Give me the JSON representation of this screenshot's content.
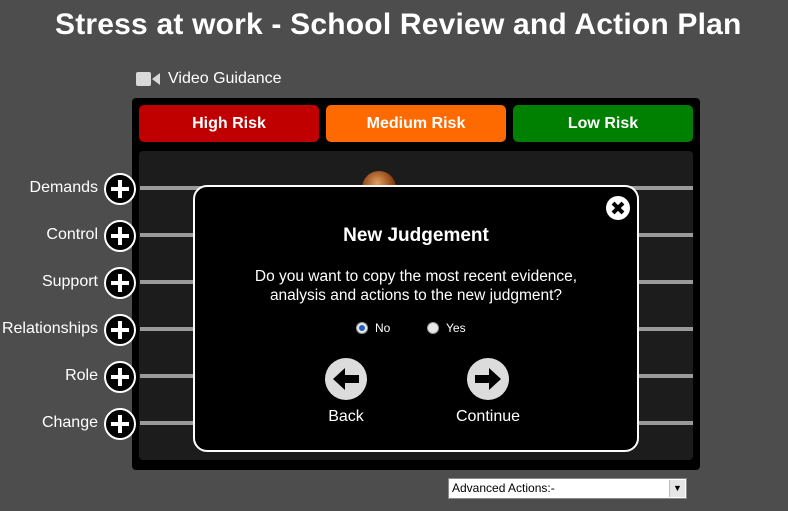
{
  "header": {
    "title": "Stress at work - School Review and Action Plan"
  },
  "video": {
    "label": "Video Guidance",
    "icon": "video-camera-icon"
  },
  "risk_buttons": [
    {
      "label": "High Risk",
      "color": "#c00000"
    },
    {
      "label": "Medium Risk",
      "color": "#ff6a00"
    },
    {
      "label": "Low Risk",
      "color": "#008000"
    }
  ],
  "rows": [
    {
      "label": "Demands"
    },
    {
      "label": "Control"
    },
    {
      "label": "Support"
    },
    {
      "label": "Relationships"
    },
    {
      "label": "Role"
    },
    {
      "label": "Change"
    }
  ],
  "modal": {
    "title": "New Judgement",
    "message_line1": "Do you want to copy the most recent evidence,",
    "message_line2": "analysis and actions to the new judgment?",
    "options": [
      {
        "label": "No",
        "selected": true
      },
      {
        "label": "Yes",
        "selected": false
      }
    ],
    "back_label": "Back",
    "continue_label": "Continue"
  },
  "advanced_actions": {
    "selected": "Advanced Actions:-"
  }
}
